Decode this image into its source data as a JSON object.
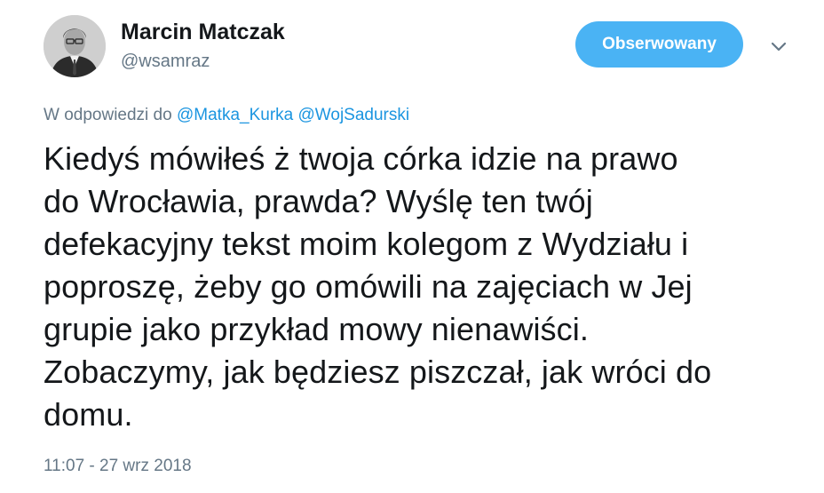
{
  "author": {
    "name": "Marcin Matczak",
    "handle": "@wsamraz",
    "avatar_icon": "profile-photo"
  },
  "follow_button": {
    "label": "Obserwowany",
    "color": "#4ab3f4"
  },
  "menu": {
    "icon": "chevron-down-icon"
  },
  "reply": {
    "prefix": "W odpowiedzi do",
    "mentions": [
      "@Matka_Kurka",
      "@WojSadurski"
    ]
  },
  "tweet": {
    "lines": [
      "Kiedyś mówiłeś ż twoja córka idzie na prawo",
      "do Wrocławia, prawda? Wyślę ten twój",
      "defekacyjny tekst moim kolegom z Wydziału i",
      "poproszę, żeby go omówili na zajęciach w Jej",
      "grupie jako przykład mowy nienawiści.",
      "Zobaczymy, jak będziesz piszczał, jak wróci do",
      "domu."
    ]
  },
  "timestamp": "11:07 - 27 wrz 2018",
  "colors": {
    "link": "#1b95e0",
    "secondary_text": "#657786",
    "primary_text": "#14171a"
  }
}
